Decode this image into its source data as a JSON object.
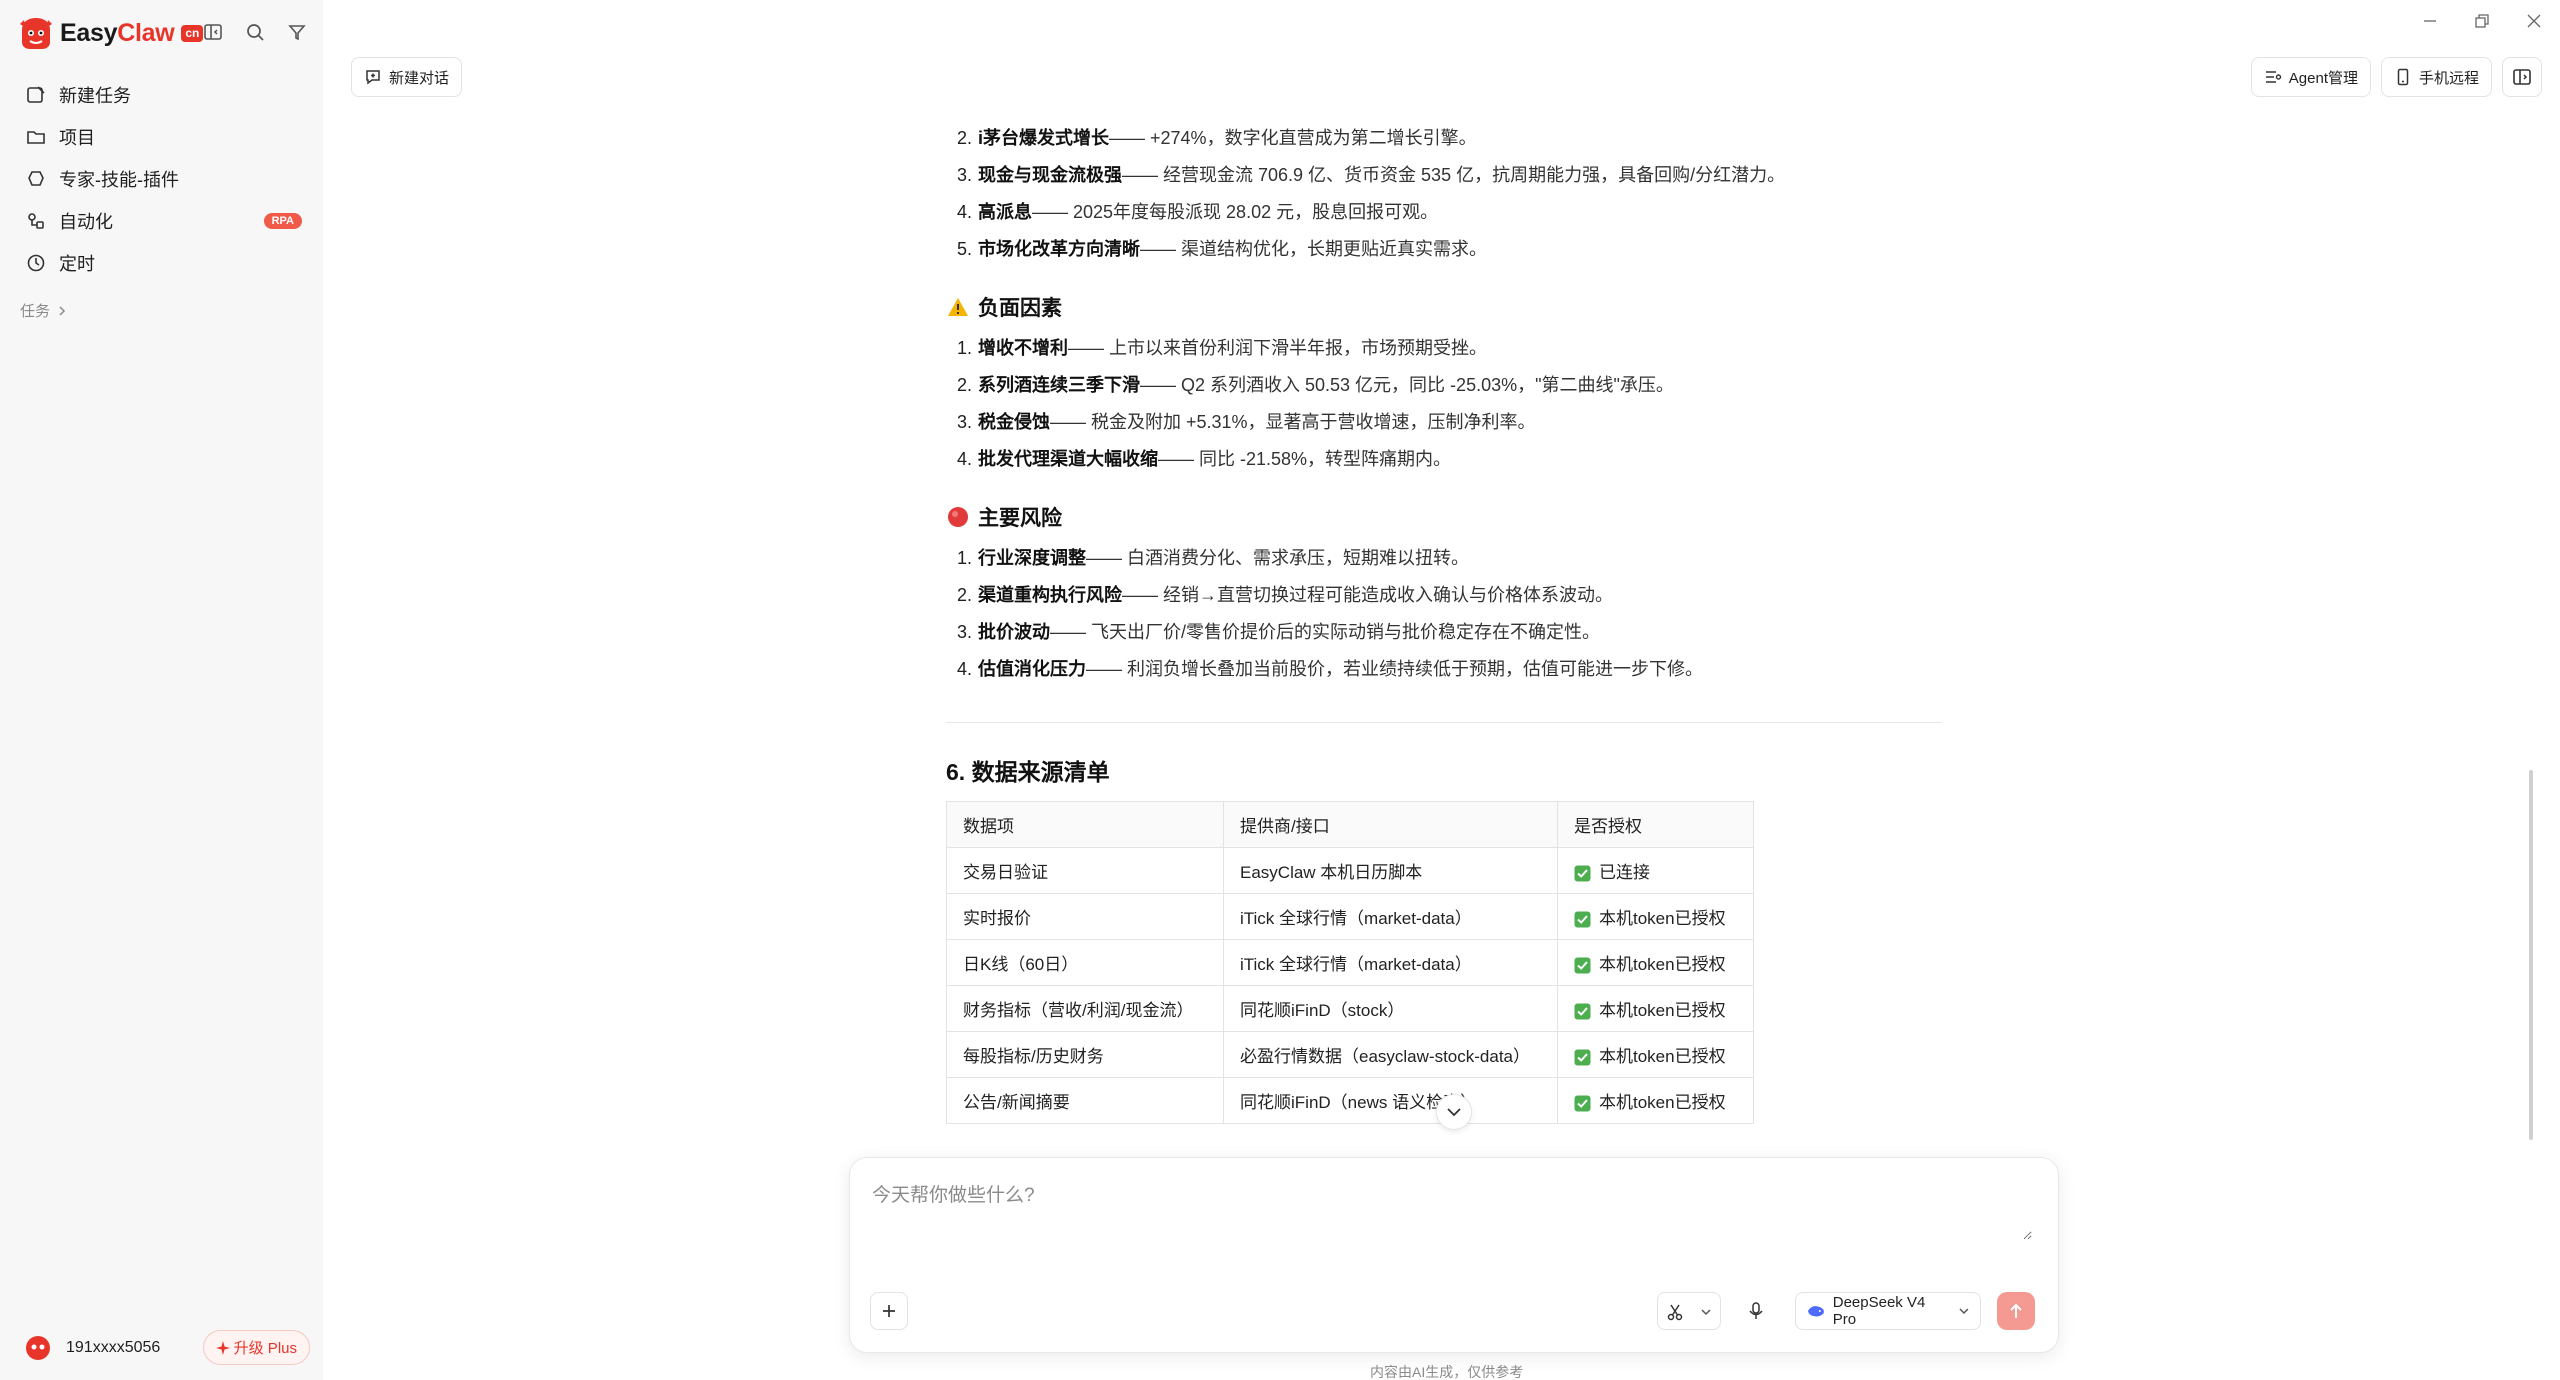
{
  "app": {
    "brand_easy": "Easy",
    "brand_claw": "Claw",
    "brand_badge": "cn"
  },
  "sidebar": {
    "items": [
      {
        "label": "新建任务",
        "icon": "new-task-icon"
      },
      {
        "label": "项目",
        "icon": "folder-icon"
      },
      {
        "label": "专家-技能-插件",
        "icon": "plugin-icon"
      },
      {
        "label": "自动化",
        "icon": "automation-icon",
        "badge": "RPA"
      },
      {
        "label": "定时",
        "icon": "clock-icon"
      }
    ],
    "tasks_label": "任务",
    "user_name": "191xxxx5056",
    "upgrade_label": "升级 Plus"
  },
  "topbar": {
    "new_chat": "新建对话",
    "agent_manage": "Agent管理",
    "mobile_remote": "手机远程"
  },
  "content": {
    "positives_partial": [
      {
        "num": "2.",
        "bold": "i茅台爆发式增长",
        "rest": " —— +274%，数字化直营成为第二增长引擎。"
      },
      {
        "num": "3.",
        "bold": "现金与现金流极强",
        "rest": " —— 经营现金流 706.9 亿、货币资金 535 亿，抗周期能力强，具备回购/分红潜力。"
      },
      {
        "num": "4.",
        "bold": "高派息",
        "rest": " —— 2025年度每股派现 28.02 元，股息回报可观。"
      },
      {
        "num": "5.",
        "bold": "市场化改革方向清晰",
        "rest": " —— 渠道结构优化，长期更贴近真实需求。"
      }
    ],
    "negatives_title": "负面因素",
    "negatives": [
      {
        "num": "1.",
        "bold": "增收不增利",
        "rest": " —— 上市以来首份利润下滑半年报，市场预期受挫。"
      },
      {
        "num": "2.",
        "bold": "系列酒连续三季下滑",
        "rest": " —— Q2 系列酒收入 50.53 亿元，同比 -25.03%，\"第二曲线\"承压。"
      },
      {
        "num": "3.",
        "bold": "税金侵蚀",
        "rest": " —— 税金及附加 +5.31%，显著高于营收增速，压制净利率。"
      },
      {
        "num": "4.",
        "bold": "批发代理渠道大幅收缩",
        "rest": " —— 同比 -21.58%，转型阵痛期内。"
      }
    ],
    "risks_title": "主要风险",
    "risks": [
      {
        "num": "1.",
        "bold": "行业深度调整",
        "rest": " —— 白酒消费分化、需求承压，短期难以扭转。"
      },
      {
        "num": "2.",
        "bold": "渠道重构执行风险",
        "rest": " —— 经销→直营切换过程可能造成收入确认与价格体系波动。"
      },
      {
        "num": "3.",
        "bold": "批价波动",
        "rest": " —— 飞天出厂价/零售价提价后的实际动销与批价稳定存在不确定性。"
      },
      {
        "num": "4.",
        "bold": "估值消化压力",
        "rest": " —— 利润负增长叠加当前股价，若业绩持续低于预期，估值可能进一步下修。"
      }
    ],
    "sources_title": "6. 数据来源清单",
    "table_headers": [
      "数据项",
      "提供商/接口",
      "是否授权"
    ],
    "table_rows": [
      [
        "交易日验证",
        "EasyClaw 本机日历脚本",
        "已连接"
      ],
      [
        "实时报价",
        "iTick 全球行情（market-data）",
        "本机token已授权"
      ],
      [
        "日K线（60日）",
        "iTick 全球行情（market-data）",
        "本机token已授权"
      ],
      [
        "财务指标（营收/利润/现金流）",
        "同花顺iFinD（stock）",
        "本机token已授权"
      ],
      [
        "每股指标/历史财务",
        "必盈行情数据（easyclaw-stock-data）",
        "本机token已授权"
      ],
      [
        "公告/新闻摘要",
        "同花顺iFinD（news 语义检索）",
        "本机token已授权"
      ]
    ]
  },
  "composer": {
    "placeholder": "今天帮你做些什么?",
    "model": "DeepSeek V4 Pro",
    "disclaimer": "内容由AI生成，仅供参考"
  },
  "colors": {
    "brand_red": "#e8352a",
    "check_green": "#4cae4f",
    "send_pink": "#f49a92"
  }
}
